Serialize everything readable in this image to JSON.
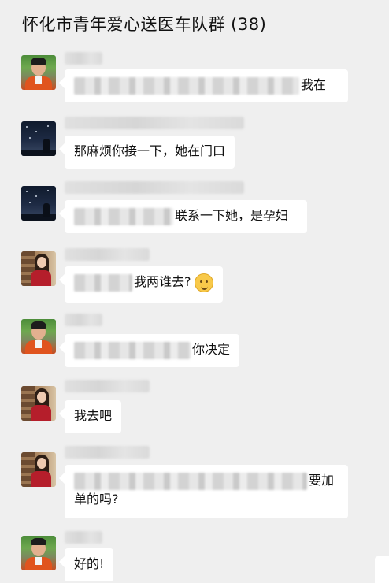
{
  "header": {
    "title": "怀化市青年爱心送医车队群 (38)"
  },
  "messages": [
    {
      "avatar": "man-portrait",
      "text": "我在"
    },
    {
      "avatar": "night-sky",
      "text": "那麻烦你接一下，她在门口"
    },
    {
      "avatar": "night-sky",
      "text": "联系一下她，是孕妇"
    },
    {
      "avatar": "woman-portrait",
      "text": "我两谁去?",
      "emoji": "thinking-face-icon"
    },
    {
      "avatar": "man-portrait",
      "text": "你决定"
    },
    {
      "avatar": "woman-portrait",
      "text": "我去吧"
    },
    {
      "avatar": "woman-portrait",
      "text_line1": "要加",
      "text_line2": "单的吗?"
    },
    {
      "avatar": "man-portrait",
      "text": "好的!"
    }
  ],
  "colors": {
    "background": "#efefef",
    "bubble": "#ffffff",
    "text": "#111111"
  }
}
